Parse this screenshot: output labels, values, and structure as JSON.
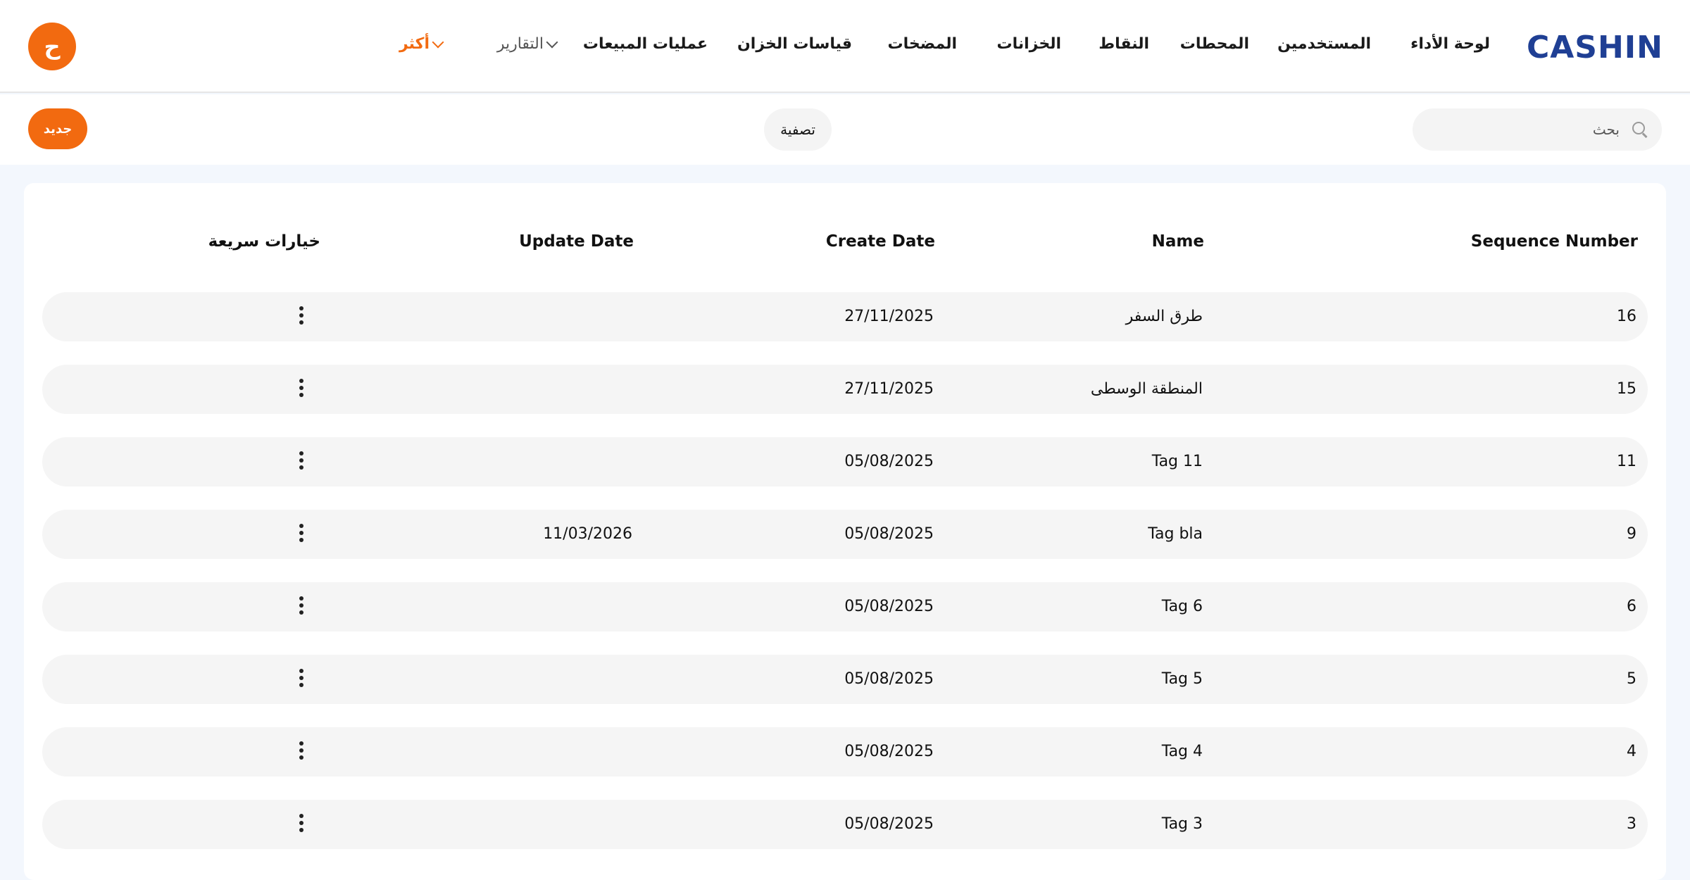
{
  "brand": {
    "logo_text": "CASHIN",
    "accent_color": "#f26a10",
    "brand_color": "#1f3f94"
  },
  "nav": {
    "items": [
      {
        "label": "لوحة الأداء"
      },
      {
        "label": "المستخدمين"
      },
      {
        "label": "المحطات"
      },
      {
        "label": "النقاط"
      },
      {
        "label": "الخزانات"
      },
      {
        "label": "المضخات"
      },
      {
        "label": "قياسات الخزان"
      },
      {
        "label": "عمليات المبيعات"
      },
      {
        "label": "التقارير"
      },
      {
        "label": "أكثر"
      }
    ],
    "avatar_letter": "ح"
  },
  "toolbar": {
    "search_placeholder": "بحث",
    "filter_label": "تصفية",
    "new_label": "جديد"
  },
  "table": {
    "columns": [
      "Sequence Number",
      "Name",
      "Create Date",
      "Update Date",
      "خيارات سريعة"
    ],
    "rows": [
      {
        "seq": "16",
        "name": "طرق السفر",
        "create": "27/11/2025",
        "update": ""
      },
      {
        "seq": "15",
        "name": "المنطقة الوسطى",
        "create": "27/11/2025",
        "update": ""
      },
      {
        "seq": "11",
        "name": "Tag 11",
        "create": "05/08/2025",
        "update": ""
      },
      {
        "seq": "9",
        "name": "Tag bla",
        "create": "05/08/2025",
        "update": "11/03/2026"
      },
      {
        "seq": "6",
        "name": "Tag 6",
        "create": "05/08/2025",
        "update": ""
      },
      {
        "seq": "5",
        "name": "Tag 5",
        "create": "05/08/2025",
        "update": ""
      },
      {
        "seq": "4",
        "name": "Tag 4",
        "create": "05/08/2025",
        "update": ""
      },
      {
        "seq": "3",
        "name": "Tag 3",
        "create": "05/08/2025",
        "update": ""
      }
    ]
  }
}
